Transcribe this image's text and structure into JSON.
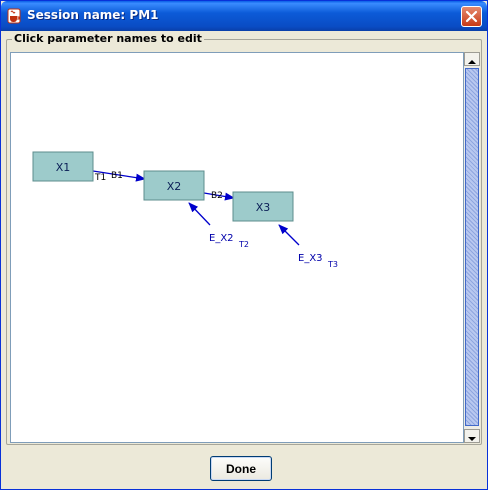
{
  "window": {
    "title": "Session name: PM1"
  },
  "panel": {
    "label": "Click parameter names to edit"
  },
  "diagram": {
    "nodes": {
      "x1": "X1",
      "x2": "X2",
      "x3": "X3"
    },
    "edges": {
      "t1": "T1",
      "b1": "B1",
      "b2": "B2"
    },
    "errors": {
      "e_x2": {
        "label": "E_X2",
        "sub": "T2"
      },
      "e_x3": {
        "label": "E_X3",
        "sub": "T3"
      }
    },
    "colors": {
      "node_fill": "#9dcbcb",
      "node_border": "#5d8c8c",
      "arrow": "#0000cc"
    }
  },
  "buttons": {
    "done": "Done"
  },
  "icons": {
    "app": "java-cup-icon",
    "close": "close-icon",
    "scroll_up": "arrow-up-icon",
    "scroll_down": "arrow-down-icon"
  }
}
